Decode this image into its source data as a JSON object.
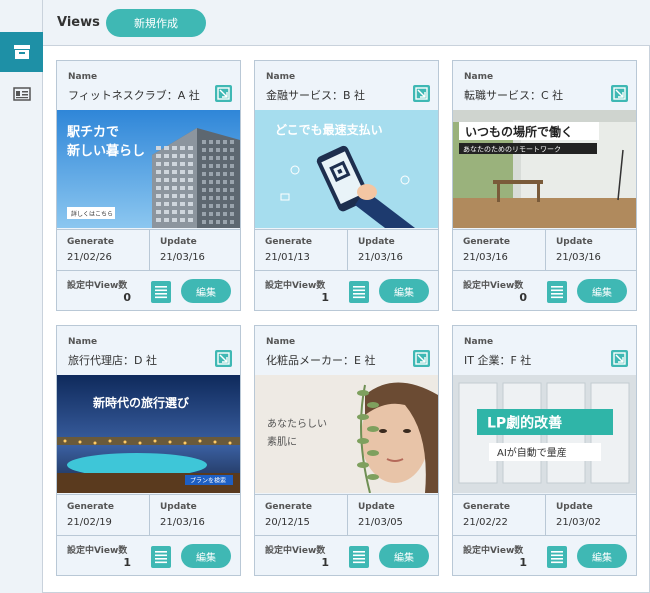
{
  "header": {
    "title": "Views",
    "new_button": "新規作成"
  },
  "labels": {
    "name": "Name",
    "generate": "Generate",
    "update": "Update",
    "views_count": "設定中View数",
    "edit": "編集"
  },
  "cards": [
    {
      "name": "フィットネスクラブ：A 社",
      "generate": "21/02/26",
      "update": "21/03/16",
      "count": "0",
      "thumb": {
        "headline1": "駅チカで",
        "headline2": "新しい暮らし",
        "tag": "詳しくはこちら"
      }
    },
    {
      "name": "金融サービス：B 社",
      "generate": "21/01/13",
      "update": "21/03/16",
      "count": "1",
      "thumb": {
        "headline1": "どこでも最速支払い"
      }
    },
    {
      "name": "転職サービス：C 社",
      "generate": "21/03/16",
      "update": "21/03/16",
      "count": "0",
      "thumb": {
        "headline1": "いつもの場所で働く",
        "headline2": "あなたのためのリモートワーク"
      }
    },
    {
      "name": "旅行代理店：D 社",
      "generate": "21/02/19",
      "update": "21/03/16",
      "count": "1",
      "thumb": {
        "headline1": "新時代の旅行選び",
        "tag": "プランを検索"
      }
    },
    {
      "name": "化粧品メーカー：E 社",
      "generate": "20/12/15",
      "update": "21/03/05",
      "count": "1",
      "thumb": {
        "headline1": "あなたらしい",
        "headline2": "素肌に"
      }
    },
    {
      "name": "IT 企業：F 社",
      "generate": "21/02/22",
      "update": "21/03/02",
      "count": "1",
      "thumb": {
        "headline1": "LP劇的改善",
        "headline2": "AIが自動で量産"
      }
    }
  ],
  "icons": {
    "sidebar_active": "archive-icon",
    "sidebar_2": "id-card-icon",
    "external": "external-link-icon",
    "list": "list-icon"
  },
  "colors": {
    "accent": "#3fb8b4",
    "sidebar_active": "#1e90a6"
  }
}
